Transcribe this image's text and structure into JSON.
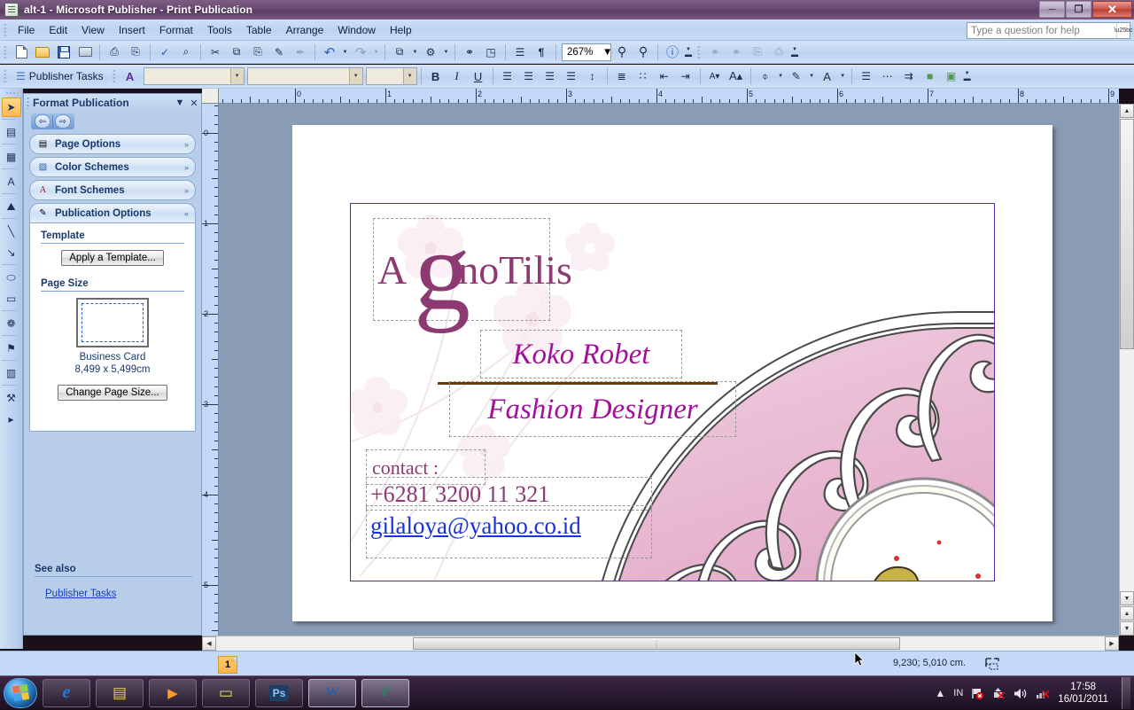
{
  "window": {
    "title": "alt-1 - Microsoft Publisher - Print Publication",
    "app_icon": "publisher-icon",
    "minimize_label": "─",
    "maximize_label": "❐",
    "close_label": "✕"
  },
  "menu": {
    "items": [
      "File",
      "Edit",
      "View",
      "Insert",
      "Format",
      "Tools",
      "Table",
      "Arrange",
      "Window",
      "Help"
    ]
  },
  "help_search": {
    "placeholder": "Type a question for help",
    "value": ""
  },
  "standard_toolbar": {
    "buttons": [
      {
        "name": "new-icon",
        "glyph": "□"
      },
      {
        "name": "open-icon",
        "glyph": "▱"
      },
      {
        "name": "save-icon",
        "glyph": "▣"
      },
      {
        "name": "email-icon",
        "glyph": "✉"
      },
      {
        "name": "print-icon",
        "glyph": "⎙"
      },
      {
        "name": "print-preview-icon",
        "glyph": "⎘"
      },
      {
        "name": "spelling-icon",
        "glyph": "✓"
      },
      {
        "name": "research-icon",
        "glyph": "⌕"
      },
      {
        "name": "cut-icon",
        "glyph": "✂"
      },
      {
        "name": "copy-icon",
        "glyph": "⧉"
      },
      {
        "name": "paste-icon",
        "glyph": "⎘"
      },
      {
        "name": "format-painter-icon",
        "glyph": "✎"
      },
      {
        "name": "clear-formatting-icon",
        "glyph": "✒"
      },
      {
        "name": "undo-icon",
        "glyph": "↶"
      },
      {
        "name": "redo-icon",
        "glyph": "↷"
      },
      {
        "name": "bring-forward-icon",
        "glyph": "⧉"
      },
      {
        "name": "design-checker-icon",
        "glyph": "⚙"
      },
      {
        "name": "insert-hyperlink-icon",
        "glyph": "⚭"
      },
      {
        "name": "design-gallery-icon",
        "glyph": "◳"
      },
      {
        "name": "special-characters-icon",
        "glyph": "¶"
      },
      {
        "name": "show-formatting-icon",
        "glyph": "≡"
      }
    ],
    "zoom_value": "267%",
    "zoom_out_label": "⊖",
    "zoom_in_label": "⊕",
    "help_icon": "help-icon"
  },
  "formatting_toolbar": {
    "publisher_tasks_label": "Publisher Tasks",
    "style_value": "",
    "font_value": "",
    "font_size_value": "",
    "bold_label": "B",
    "italic_label": "I",
    "underline_label": "U",
    "align_left": "align-left-icon",
    "align_center": "align-center-icon",
    "align_right": "align-right-icon",
    "justify": "justify-icon",
    "line_spacing": "line-spacing-icon",
    "numbered_list": "numbered-list-icon",
    "bulleted_list": "bulleted-list-icon",
    "decrease_indent": "decrease-indent-icon",
    "increase_indent": "increase-indent-icon",
    "decrease_font": "decrease-font-icon",
    "increase_font": "increase-font-icon",
    "fill_color": "fill-color-icon",
    "line_color": "line-color-icon",
    "font_color": "font-color-icon",
    "line_style": "line-style-icon",
    "dash_style": "dash-style-icon",
    "arrow_style": "arrow-style-icon",
    "shadow_style": "shadow-style-icon",
    "3d_style": "3d-style-icon"
  },
  "objects_toolbar": {
    "items": [
      {
        "name": "select-objects-tool",
        "glyph": "➤",
        "selected": true
      },
      {
        "name": "text-box-tool",
        "glyph": "▤"
      },
      {
        "name": "insert-table-tool",
        "glyph": "▦"
      },
      {
        "name": "wordart-tool",
        "glyph": "A"
      },
      {
        "name": "picture-frame-tool",
        "glyph": "⛰"
      },
      {
        "name": "line-tool",
        "glyph": "╲"
      },
      {
        "name": "arrow-tool",
        "glyph": "↘"
      },
      {
        "name": "oval-tool",
        "glyph": "⬭"
      },
      {
        "name": "rectangle-tool",
        "glyph": "▭"
      },
      {
        "name": "autoshapes-tool",
        "glyph": "❁"
      },
      {
        "name": "design-gallery-tool",
        "glyph": "⚑"
      },
      {
        "name": "item-from-content-library-tool",
        "glyph": "▥"
      },
      {
        "name": "design-gallery-object-tool",
        "glyph": "⚒"
      },
      {
        "name": "objects-toolbar-expand",
        "glyph": "▸"
      }
    ]
  },
  "task_pane": {
    "title": "Format Publication",
    "dropdown_label": "▼",
    "close_label": "✕",
    "nav_back_label": "⇦",
    "nav_forward_label": "⇨",
    "sections": [
      {
        "label": "Page Options",
        "icon": "page-options-icon",
        "chevron": "»",
        "expanded": false
      },
      {
        "label": "Color Schemes",
        "icon": "color-schemes-icon",
        "chevron": "»",
        "expanded": false
      },
      {
        "label": "Font Schemes",
        "icon": "font-schemes-icon",
        "chevron": "»",
        "expanded": false
      },
      {
        "label": "Publication Options",
        "icon": "publication-options-icon",
        "chevron": "«",
        "expanded": true
      }
    ],
    "template_group_label": "Template",
    "apply_template_button": "Apply a Template...",
    "page_size_group_label": "Page Size",
    "page_size_name": "Business Card",
    "page_size_dims": "8,499 x 5,499cm",
    "change_page_size_button": "Change Page Size...",
    "see_also_label": "See also",
    "see_also_link": "Publisher Tasks"
  },
  "rulers": {
    "horizontal_ticks": [
      "0",
      "1",
      "2",
      "3",
      "4",
      "5",
      "6",
      "7",
      "8",
      "9"
    ],
    "vertical_ticks": [
      "0",
      "1",
      "2",
      "3",
      "4",
      "5"
    ],
    "unit": "cm"
  },
  "document": {
    "logo_prefix": "A",
    "logo_big_letter": "g",
    "logo_suffix": "noTilis",
    "name": "Koko Robet",
    "job_title": "Fashion Designer",
    "contact_label": "contact :",
    "phone": "+6281 3200 11 321",
    "email": "gilaloya@yahoo.co.id",
    "colors": {
      "logo": "#8e3a72",
      "name": "#a3119b",
      "rule": "#6b3a0d",
      "email": "#1a33d8",
      "ornament_pink": "#e7b8d2",
      "frame": "#5b2d9b"
    }
  },
  "status_bar": {
    "page_number": "1",
    "coordinates": "9,230; 5,010 cm.",
    "object_size_icon": "object-size-icon"
  },
  "taskbar": {
    "start_label": "start-orb",
    "items": [
      {
        "name": "taskbar-internet-explorer",
        "glyph": "e",
        "active": false
      },
      {
        "name": "taskbar-windows-explorer",
        "glyph": "▤",
        "active": false
      },
      {
        "name": "taskbar-media-player",
        "glyph": "▶",
        "active": false
      },
      {
        "name": "taskbar-sticky-notes",
        "glyph": "▭",
        "active": false
      },
      {
        "name": "taskbar-photoshop",
        "glyph": "Ps",
        "active": false
      },
      {
        "name": "taskbar-word",
        "glyph": "W",
        "active": true
      },
      {
        "name": "taskbar-publisher",
        "glyph": "P",
        "active": true
      }
    ],
    "tray": {
      "show_hidden_label": "▲",
      "input_language": "IN",
      "action_center_icon": "flag-icon",
      "safely-remove_icon": "eject-icon",
      "volume_icon": "volume-icon",
      "network_icon": "network-icon",
      "time": "17:58",
      "date": "16/01/2011"
    }
  }
}
